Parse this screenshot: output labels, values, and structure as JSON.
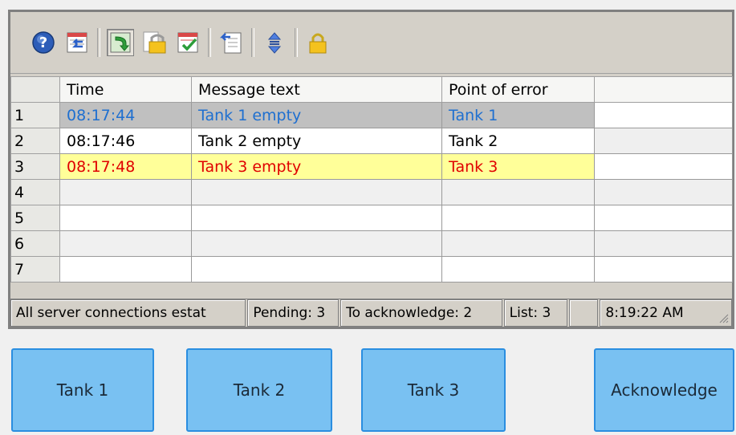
{
  "toolbar": {
    "icons": [
      "help-icon",
      "loop-in-alarm-icon",
      "toggle-list-icon",
      "lock-icon",
      "acknowledge-icon",
      "export-icon",
      "sort-icon",
      "lock-all-icon"
    ]
  },
  "table": {
    "headers": [
      "",
      "Time",
      "Message text",
      "Point of error",
      ""
    ],
    "rows": [
      {
        "num": "1",
        "time": "08:17:44",
        "message": "Tank 1 empty",
        "point": "Tank 1"
      },
      {
        "num": "2",
        "time": "08:17:46",
        "message": "Tank 2 empty",
        "point": "Tank 2"
      },
      {
        "num": "3",
        "time": "08:17:48",
        "message": "Tank 3 empty",
        "point": "Tank 3"
      },
      {
        "num": "4",
        "time": "",
        "message": "",
        "point": ""
      },
      {
        "num": "5",
        "time": "",
        "message": "",
        "point": ""
      },
      {
        "num": "6",
        "time": "",
        "message": "",
        "point": ""
      },
      {
        "num": "7",
        "time": "",
        "message": "",
        "point": ""
      }
    ]
  },
  "status": {
    "connection": "All  server connections estat",
    "pending": "Pending: 3",
    "to_acknowledge": "To acknowledge: 2",
    "list": "List: 3",
    "blank": "",
    "time": "8:19:22 AM"
  },
  "buttons": {
    "tank1": "Tank 1",
    "tank2": "Tank 2",
    "tank3": "Tank 3",
    "acknowledge": "Acknowledge"
  },
  "colors": {
    "blue_text": "#1e6fd0",
    "red_text": "#e00000",
    "selected_row": "#c0c0c0",
    "warning_row": "#ffff99",
    "button_fill": "#79c1f2"
  }
}
